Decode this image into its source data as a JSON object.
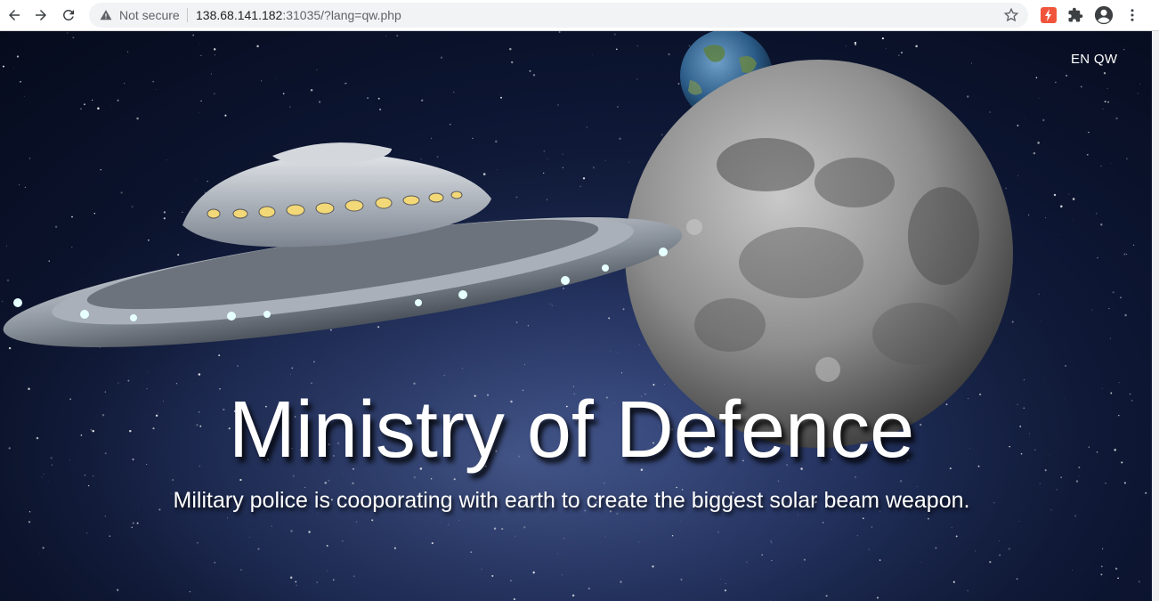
{
  "browser": {
    "security_label": "Not secure",
    "url_host": "138.68.141.182",
    "url_rest": ":31035/?lang=qw.php"
  },
  "page": {
    "lang_options": [
      "EN",
      "QW"
    ],
    "title": "Ministry of Defence",
    "subtitle": "Military police is cooporating with earth to create the biggest solar beam weapon."
  },
  "icons": {
    "back": "back-arrow-icon",
    "forward": "forward-arrow-icon",
    "reload": "reload-icon",
    "warning": "warning-icon",
    "bookmark": "star-icon",
    "extension_red": "lightning-extension-icon",
    "extensions": "puzzle-icon",
    "profile": "account-circle-icon",
    "menu": "kebab-menu-icon"
  },
  "colors": {
    "accent_extension": "#f0553b",
    "page_text": "#ffffff"
  }
}
